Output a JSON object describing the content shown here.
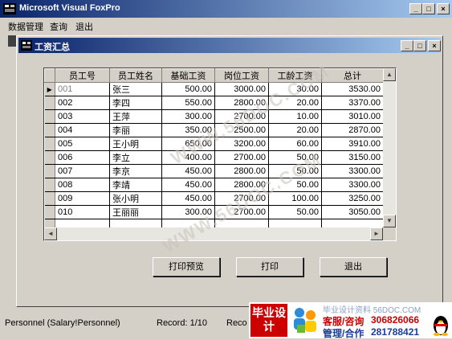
{
  "app": {
    "title": "Microsoft Visual FoxPro"
  },
  "menu": [
    "数据管理",
    "查询",
    "退出"
  ],
  "window": {
    "title": "工资汇总"
  },
  "table": {
    "columns": [
      "员工号",
      "员工姓名",
      "基础工资",
      "岗位工资",
      "工龄工资",
      "总计"
    ],
    "rows": [
      [
        "001",
        "张三",
        "500.00",
        "3000.00",
        "30.00",
        "3530.00"
      ],
      [
        "002",
        "李四",
        "550.00",
        "2800.00",
        "20.00",
        "3370.00"
      ],
      [
        "003",
        "王萍",
        "300.00",
        "2700.00",
        "10.00",
        "3010.00"
      ],
      [
        "004",
        "李丽",
        "350.00",
        "2500.00",
        "20.00",
        "2870.00"
      ],
      [
        "005",
        "王小明",
        "650.00",
        "3200.00",
        "60.00",
        "3910.00"
      ],
      [
        "006",
        "李立",
        "400.00",
        "2700.00",
        "50.00",
        "3150.00"
      ],
      [
        "007",
        "李京",
        "450.00",
        "2800.00",
        "50.00",
        "3300.00"
      ],
      [
        "008",
        "李靖",
        "450.00",
        "2800.00",
        "50.00",
        "3300.00"
      ],
      [
        "009",
        "张小明",
        "450.00",
        "2700.00",
        "100.00",
        "3250.00"
      ],
      [
        "010",
        "王丽丽",
        "300.00",
        "2700.00",
        "50.00",
        "3050.00"
      ]
    ]
  },
  "buttons": {
    "print_preview": "打印预览",
    "print": "打印",
    "exit": "退出"
  },
  "status": {
    "table": "Personnel (Salary!Personnel)",
    "record": "Record: 1/10",
    "extra": "Reco"
  },
  "watermark": "WWW.56DOC.COM",
  "ad": {
    "logo_text": "毕业设计",
    "line1": "毕业设计资料 56DOC.COM",
    "service_label": "客服/咨询",
    "service_number": "306826066",
    "manage_label": "管理/合作",
    "manage_number": "281788421"
  },
  "colors": {
    "titlebar": "#0a246a",
    "ad_red": "#cc0000",
    "ad_blue": "#1a3c9c"
  }
}
